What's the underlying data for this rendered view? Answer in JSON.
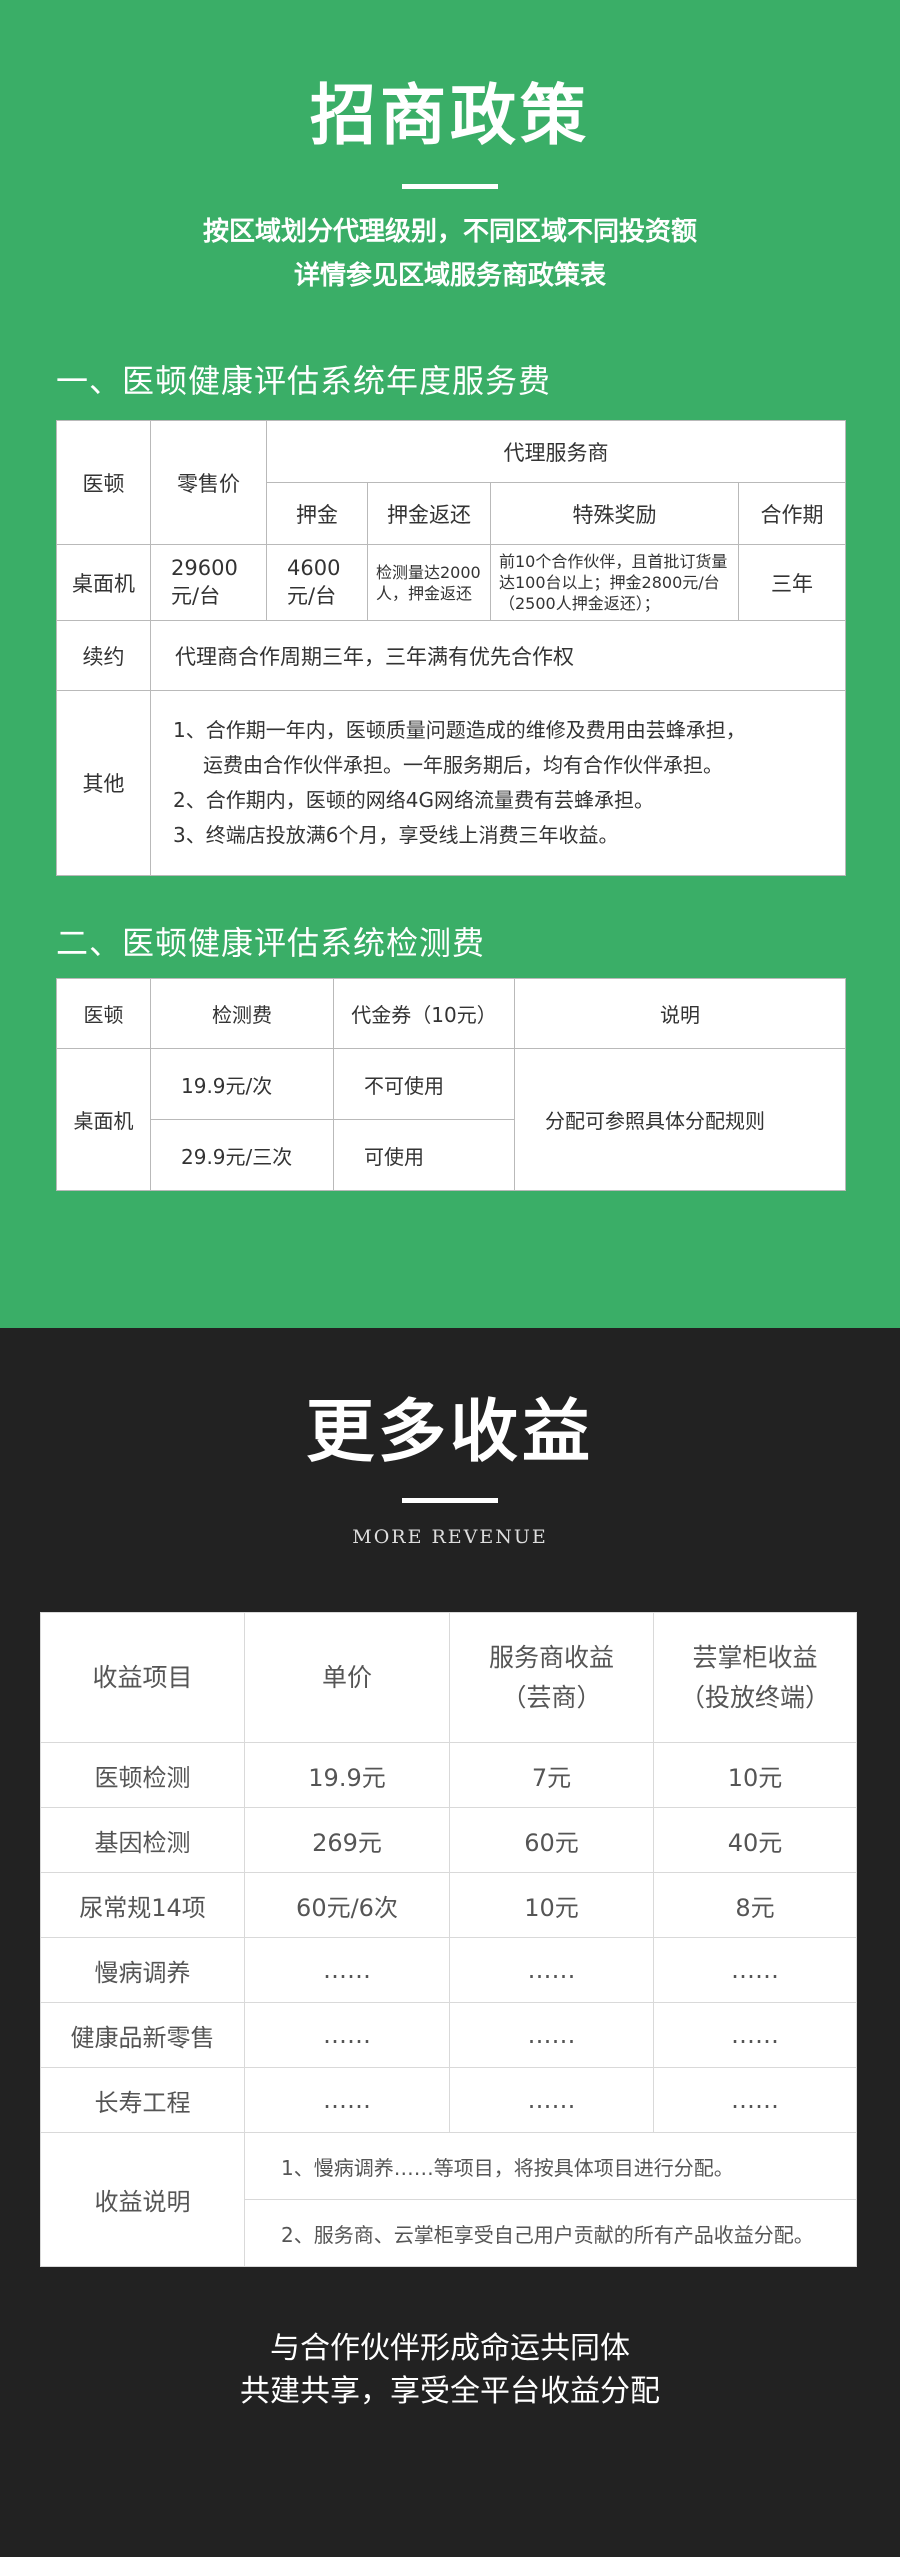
{
  "policy": {
    "title": "招商政策",
    "intro": [
      "按区域划分代理级别，不同区域不同投资额",
      "详情参见区域服务商政策表"
    ],
    "section1_title": "一、医顿健康评估系统年度服务费",
    "table1": {
      "h_product": "医顿",
      "h_retail": "零售价",
      "h_agent": "代理服务商",
      "h_deposit": "押金",
      "h_refund": "押金返还",
      "h_bonus": "特殊奖励",
      "h_term": "合作期",
      "row_product": "桌面机",
      "row_retail": [
        "29600",
        "元/台"
      ],
      "row_deposit": [
        "4600",
        "元/台"
      ],
      "row_refund": [
        "检测量达2000",
        "人，押金返还"
      ],
      "row_bonus": [
        "前10个合作伙伴，且首批订货量",
        "达100台以上；押金2800元/台",
        "（2500人押金返还）；"
      ],
      "row_term": "三年",
      "renew_label": "续约",
      "renew_text": "代理商合作周期三年，三年满有优先合作权",
      "other_label": "其他",
      "other_lines": [
        "1、合作期一年内，医顿质量问题造成的维修及费用由芸蜂承担，",
        "运费由合作伙伴承担。一年服务期后，均有合作伙伴承担。",
        "2、合作期内，医顿的网络4G网络流量费有芸蜂承担。",
        "3、终端店投放满6个月，享受线上消费三年收益。"
      ]
    },
    "section2_title": "二、医顿健康评估系统检测费",
    "table2": {
      "h_product": "医顿",
      "h_fee": "检测费",
      "h_coupon": "代金券（10元）",
      "h_desc": "说明",
      "row_product": "桌面机",
      "fee1": "19.9元/次",
      "coupon1": "不可使用",
      "fee2": "29.9元/三次",
      "coupon2": "可使用",
      "desc": "分配可参照具体分配规则"
    }
  },
  "revenue": {
    "title": "更多收益",
    "subtitle": "MORE REVENUE",
    "table": {
      "h_item": "收益项目",
      "h_price": "单价",
      "h_provider": [
        "服务商收益",
        "（芸商）"
      ],
      "h_cabinet": [
        "芸掌柜收益",
        "（投放终端）"
      ],
      "rows": [
        {
          "item": "医顿检测",
          "price": "19.9元",
          "provider": "7元",
          "cabinet": "10元"
        },
        {
          "item": "基因检测",
          "price": "269元",
          "provider": "60元",
          "cabinet": "40元"
        },
        {
          "item": "尿常规14项",
          "price": "60元/6次",
          "provider": "10元",
          "cabinet": "8元"
        },
        {
          "item": "慢病调养",
          "price": "……",
          "provider": "……",
          "cabinet": "……"
        },
        {
          "item": "健康品新零售",
          "price": "……",
          "provider": "……",
          "cabinet": "……"
        },
        {
          "item": "长寿工程",
          "price": "……",
          "provider": "……",
          "cabinet": "……"
        }
      ],
      "note_label": "收益说明",
      "notes": [
        "1、慢病调养……等项目，将按具体项目进行分配。",
        "2、服务商、云掌柜享受自己用户贡献的所有产品收益分配。"
      ]
    },
    "closing": [
      "与合作伙伴形成命运共同体",
      "共建共享，享受全平台收益分配"
    ]
  }
}
